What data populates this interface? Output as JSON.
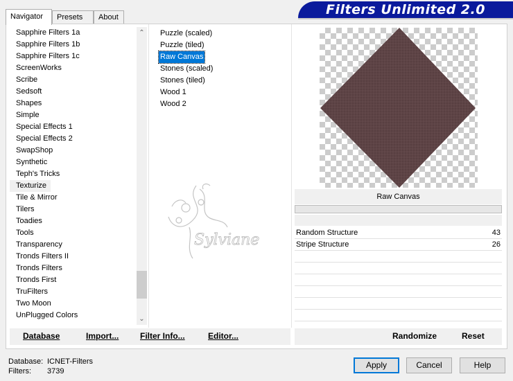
{
  "tabs": [
    "Navigator",
    "Presets",
    "About"
  ],
  "banner": "Filters Unlimited 2.0",
  "categories": [
    "Sapphire Filters 1a",
    "Sapphire Filters 1b",
    "Sapphire Filters 1c",
    "ScreenWorks",
    "Scribe",
    "Sedsoft",
    "Shapes",
    "Simple",
    "Special Effects 1",
    "Special Effects 2",
    "SwapShop",
    "Synthetic",
    "Teph's Tricks",
    "Texturize",
    "Tile & Mirror",
    "Tilers",
    "Toadies",
    "Tools",
    "Transparency",
    "Tronds Filters II",
    "Tronds Filters",
    "Tronds First",
    "TruFilters",
    "Two Moon",
    "UnPlugged Colors"
  ],
  "selected_category": "Texturize",
  "filters": [
    "Puzzle (scaled)",
    "Puzzle (tiled)",
    "Raw Canvas",
    "Stones (scaled)",
    "Stones (tiled)",
    "Wood 1",
    "Wood 2"
  ],
  "selected_filter": "Raw Canvas",
  "watermark_text": "Sylviane",
  "preview": {
    "shape_color": "#5e4446"
  },
  "filter_name": "Raw Canvas",
  "params": [
    {
      "label": "Random Structure",
      "value": "43"
    },
    {
      "label": "Stripe Structure",
      "value": "26"
    }
  ],
  "buttons_left": {
    "database": "Database",
    "import": "Import...",
    "filter_info": "Filter Info...",
    "editor": "Editor..."
  },
  "buttons_right": {
    "randomize": "Randomize",
    "reset": "Reset"
  },
  "info": {
    "database_label": "Database:",
    "database_value": "ICNET-Filters",
    "filters_label": "Filters:",
    "filters_value": "3739"
  },
  "dialog": {
    "apply": "Apply",
    "cancel": "Cancel",
    "help": "Help"
  }
}
